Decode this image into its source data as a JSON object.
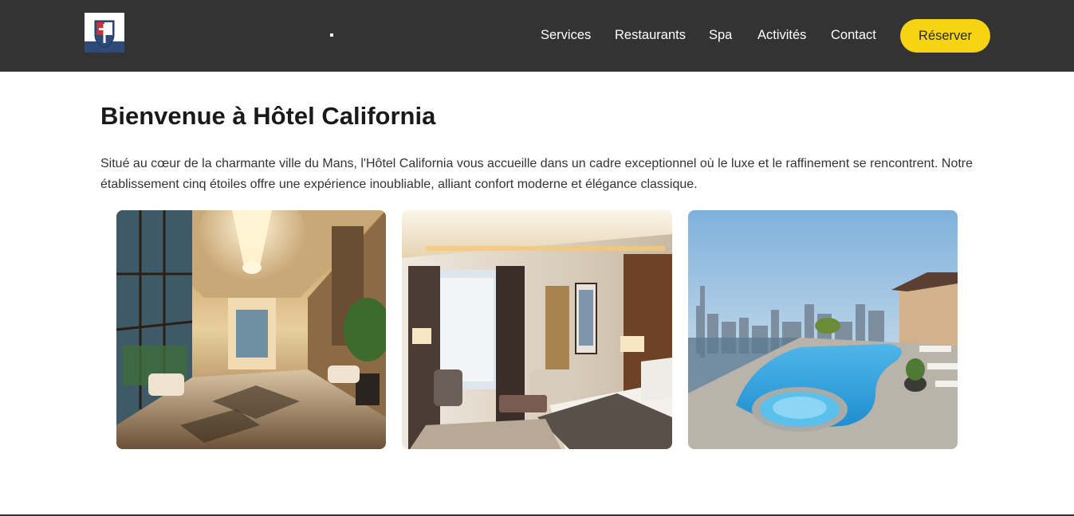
{
  "header": {
    "logo_icon": "hotel-crest-icon",
    "nav": [
      {
        "label": "Services"
      },
      {
        "label": "Restaurants"
      },
      {
        "label": "Spa"
      },
      {
        "label": "Activités"
      },
      {
        "label": "Contact"
      }
    ],
    "cta_label": "Réserver",
    "colors": {
      "bar": "#333333",
      "cta": "#f7d411"
    }
  },
  "main": {
    "title": "Bienvenue à Hôtel California",
    "intro": "Situé au cœur de la charmante ville du Mans, l'Hôtel California vous accueille dans un cadre exceptionnel où le luxe et le raffinement se rencontrent. Notre établissement cinq étoiles offre une expérience inoubliable, alliant confort moderne et élégance classique."
  },
  "gallery": [
    {
      "subject": "lobby-photo"
    },
    {
      "subject": "bedroom-photo"
    },
    {
      "subject": "rooftop-pool-photo"
    }
  ]
}
